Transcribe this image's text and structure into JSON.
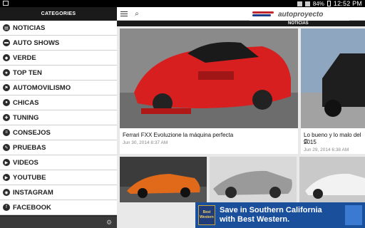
{
  "status": {
    "battery": "84%",
    "time": "12:52 PM"
  },
  "sidebar": {
    "header": "CATEGORIES",
    "items": [
      {
        "label": "NOTICIAS"
      },
      {
        "label": "AUTO SHOWS"
      },
      {
        "label": "VERDE"
      },
      {
        "label": "TOP TEN"
      },
      {
        "label": "AUTOMOVILISMO"
      },
      {
        "label": "CHICAS"
      },
      {
        "label": "TUNING"
      },
      {
        "label": "CONSEJOS"
      },
      {
        "label": "PRUEBAS"
      },
      {
        "label": "VIDEOS"
      },
      {
        "label": "YOUTUBE"
      },
      {
        "label": "INSTAGRAM"
      },
      {
        "label": "FACEBOOK"
      }
    ]
  },
  "toolbar": {
    "brand": "autoproyecto",
    "section": "NOTICIAS"
  },
  "articles": [
    {
      "title": "Ferrari FXX Evoluzione la máquina perfecta",
      "date": "Jun 30, 2014 8:37 AM"
    },
    {
      "title": "Lo bueno y lo malo del C",
      "title2": "2015",
      "date": "Jun 29, 2014 6:38 AM"
    }
  ],
  "ad": {
    "logo_text": "Best Western",
    "line1": "Save in Southern California",
    "line2": "with Best Western."
  }
}
